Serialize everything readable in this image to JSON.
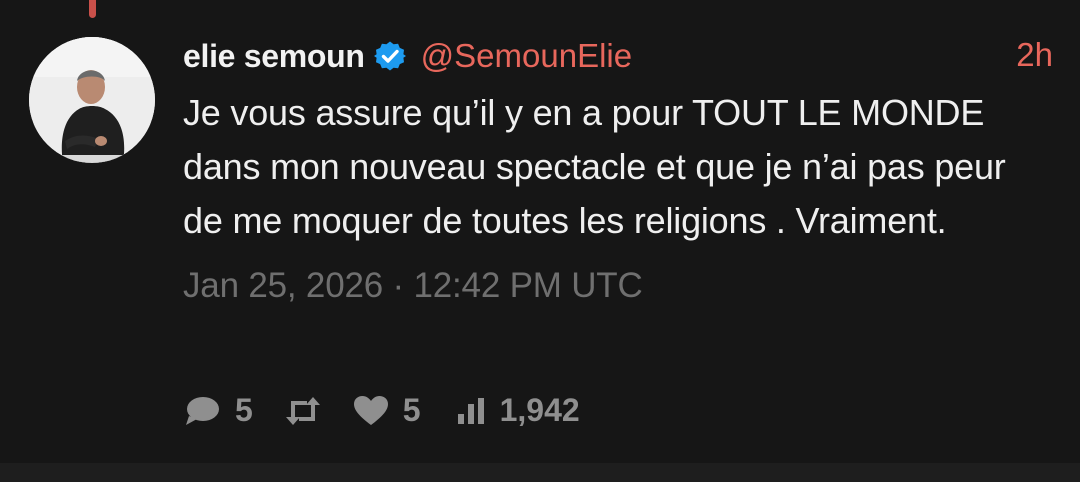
{
  "tweet": {
    "author_name": "elie semoun",
    "author_handle": "@SemounElie",
    "relative_time": "2h",
    "text": "Je vous assure qu’il y en a pour TOUT LE MONDE dans mon nouveau spectacle et que je n’ai pas peur de me moquer de toutes les religions . Vraiment.",
    "timestamp": "Jan 25, 2026 · 12:42 PM UTC",
    "verified": true
  },
  "stats": {
    "replies": "5",
    "likes": "5",
    "views": "1,942"
  },
  "colors": {
    "background": "#161616",
    "accent": "#e8675c",
    "verified": "#1d9bf0",
    "muted": "#8f8f8f"
  },
  "icons": {
    "reply": "speech-bubble-icon",
    "retweet": "retweet-icon",
    "like": "heart-icon",
    "views": "bar-chart-icon",
    "verified": "verified-badge-icon"
  }
}
